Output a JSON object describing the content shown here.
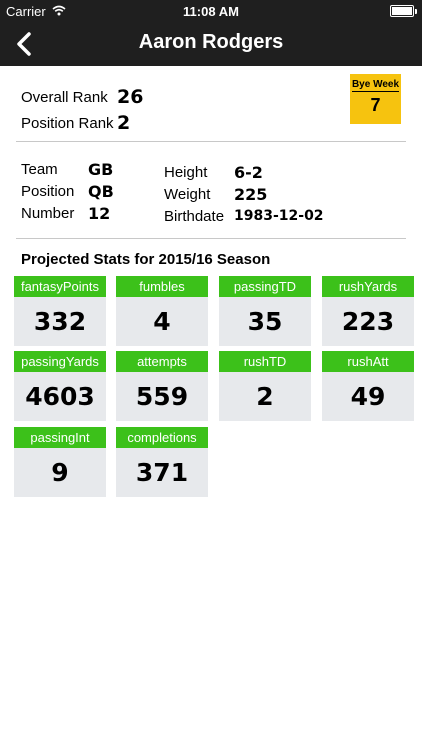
{
  "status_bar": {
    "carrier": "Carrier",
    "time": "11:08 AM",
    "battery_level": 1.0
  },
  "nav": {
    "title": "Aaron Rodgers"
  },
  "ranks": {
    "overall_label": "Overall Rank",
    "overall_value": "26",
    "position_label": "Position Rank",
    "position_value": "2"
  },
  "bye_week": {
    "label": "Bye Week",
    "value": "7",
    "color": "#f6c30f"
  },
  "info": {
    "team_label": "Team",
    "team_value": "GB",
    "position_label": "Position",
    "position_value": "QB",
    "number_label": "Number",
    "number_value": "12",
    "height_label": "Height",
    "height_value": "6-2",
    "weight_label": "Weight",
    "weight_value": "225",
    "birthdate_label": "Birthdate",
    "birthdate_value": "1983-12-02"
  },
  "projected": {
    "title": "Projected Stats for 2015/16 Season",
    "header_color": "#3cc11a",
    "stats": [
      {
        "label": "fantasyPoints",
        "value": "332"
      },
      {
        "label": "fumbles",
        "value": "4"
      },
      {
        "label": "passingTD",
        "value": "35"
      },
      {
        "label": "rushYards",
        "value": "223"
      },
      {
        "label": "passingYards",
        "value": "4603"
      },
      {
        "label": "attempts",
        "value": "559"
      },
      {
        "label": "rushTD",
        "value": "2"
      },
      {
        "label": "rushAtt",
        "value": "49"
      },
      {
        "label": "passingInt",
        "value": "9"
      },
      {
        "label": "completions",
        "value": "371"
      }
    ]
  }
}
